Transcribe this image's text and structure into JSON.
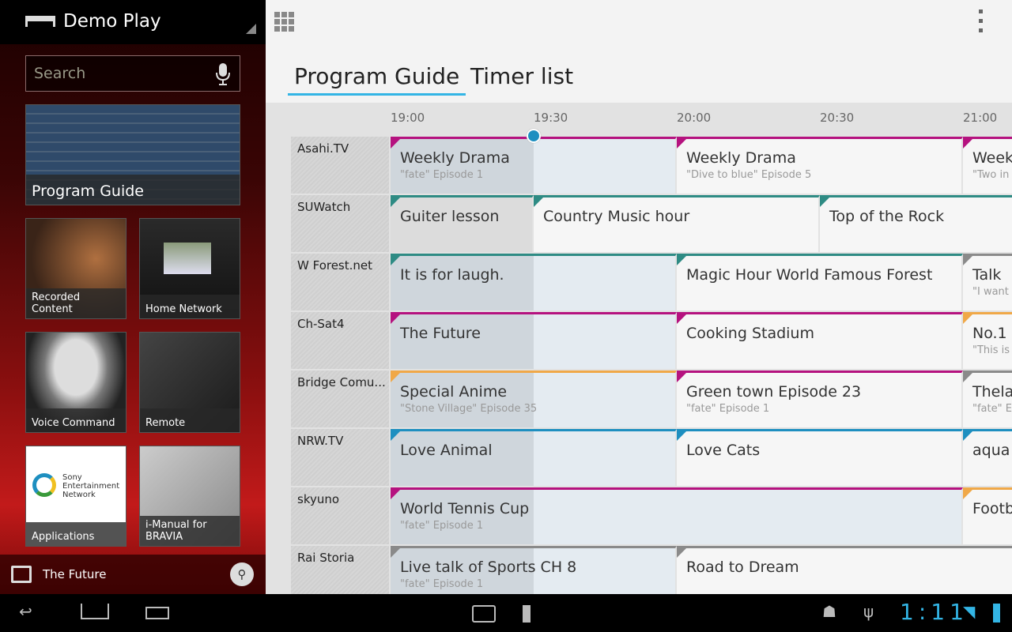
{
  "app": {
    "title": "Demo Play"
  },
  "search": {
    "placeholder": "Search"
  },
  "tiles": [
    {
      "label": "Program Guide"
    },
    {
      "label": "Recorded Content"
    },
    {
      "label": "Home Network"
    },
    {
      "label": "Voice Command"
    },
    {
      "label": "Remote"
    },
    {
      "label": "Applications"
    },
    {
      "label": "i-Manual for BRAVIA"
    }
  ],
  "applications_logo": "Sony Entertainment Network",
  "now_playing": {
    "label": "The Future"
  },
  "tabs": [
    {
      "label": "Program Guide",
      "active": true
    },
    {
      "label": "Timer list",
      "active": false
    }
  ],
  "guide": {
    "current_time": "19:30",
    "time_ticks": [
      "19:00",
      "19:30",
      "20:00",
      "20:30",
      "21:00"
    ],
    "category_colors": {
      "drama": "#b5127f",
      "music": "#2e8b84",
      "anime": "#f0a848",
      "animal": "#1e8fc0",
      "talk": "#8a8a8a"
    },
    "channels": [
      {
        "name": "Asahi.TV",
        "logo": "tower",
        "programs": [
          {
            "title": "Weekly Drama",
            "sub": "\"fate\" Episode 1",
            "start": "19:00",
            "end": "20:00",
            "cat": "drama"
          },
          {
            "title": "Weekly Drama",
            "sub": "\"Dive to blue\" Episode 5",
            "start": "20:00",
            "end": "21:00",
            "cat": "drama"
          },
          {
            "title": "Weekly Drama",
            "sub": "\"Two in",
            "start": "21:00",
            "end": "22:00",
            "cat": "drama"
          }
        ]
      },
      {
        "name": "SUWatch",
        "logo": "SUWATCH",
        "programs": [
          {
            "title": "Guiter lesson",
            "sub": "",
            "start": "19:00",
            "end": "19:30",
            "cat": "music"
          },
          {
            "title": "Country Music hour",
            "sub": "",
            "start": "19:30",
            "end": "20:30",
            "cat": "music"
          },
          {
            "title": "Top of the Rock",
            "sub": "",
            "start": "20:30",
            "end": "21:30",
            "cat": "music"
          }
        ]
      },
      {
        "name": "W Forest.net",
        "logo": "DoubleForest",
        "programs": [
          {
            "title": "It is for laugh.",
            "sub": "",
            "start": "19:00",
            "end": "20:00",
            "cat": "music"
          },
          {
            "title": "Magic Hour World Famous Forest",
            "sub": "",
            "start": "20:00",
            "end": "21:00",
            "cat": "music"
          },
          {
            "title": "Talk",
            "sub": "\"I want",
            "start": "21:00",
            "end": "22:00",
            "cat": "talk"
          }
        ]
      },
      {
        "name": "Ch-Sat4",
        "logo": "Ch-Sat4",
        "programs": [
          {
            "title": "The Future",
            "sub": "",
            "start": "19:00",
            "end": "20:00",
            "cat": "drama"
          },
          {
            "title": "Cooking Stadium",
            "sub": "",
            "start": "20:00",
            "end": "21:00",
            "cat": "drama"
          },
          {
            "title": "No.1",
            "sub": "\"This is",
            "start": "21:00",
            "end": "22:00",
            "cat": "anime"
          }
        ]
      },
      {
        "name": "Bridge Comu...",
        "logo": "bridge",
        "programs": [
          {
            "title": "Special Anime",
            "sub": "\"Stone Village\" Episode 35",
            "start": "19:00",
            "end": "20:00",
            "cat": "anime"
          },
          {
            "title": "Green town Episode 23",
            "sub": "\"fate\" Episode 1",
            "start": "20:00",
            "end": "21:00",
            "cat": "drama"
          },
          {
            "title": "Thela",
            "sub": "\"fate\" E",
            "start": "21:00",
            "end": "22:00",
            "cat": "talk"
          }
        ]
      },
      {
        "name": "NRW.TV",
        "logo": "glasses",
        "programs": [
          {
            "title": "Love Animal",
            "sub": "",
            "start": "19:00",
            "end": "20:00",
            "cat": "animal"
          },
          {
            "title": "Love Cats",
            "sub": "",
            "start": "20:00",
            "end": "21:00",
            "cat": "animal"
          },
          {
            "title": "aqua",
            "sub": "",
            "start": "21:00",
            "end": "22:00",
            "cat": "animal"
          }
        ]
      },
      {
        "name": "skyuno",
        "logo": "Lyra Star",
        "programs": [
          {
            "title": "World Tennis Cup",
            "sub": "\"fate\" Episode 1",
            "start": "19:00",
            "end": "21:00",
            "cat": "drama"
          },
          {
            "title": "Footb",
            "sub": "",
            "start": "21:00",
            "end": "22:00",
            "cat": "anime"
          }
        ]
      },
      {
        "name": "Rai Storia",
        "logo": "arrows",
        "programs": [
          {
            "title": "Live talk of Sports CH 8",
            "sub": "\"fate\" Episode 1",
            "start": "19:00",
            "end": "20:00",
            "cat": "talk"
          },
          {
            "title": "Road to Dream",
            "sub": "",
            "start": "20:00",
            "end": "22:00",
            "cat": "talk"
          }
        ]
      }
    ]
  },
  "status": {
    "clock": "1:11"
  }
}
